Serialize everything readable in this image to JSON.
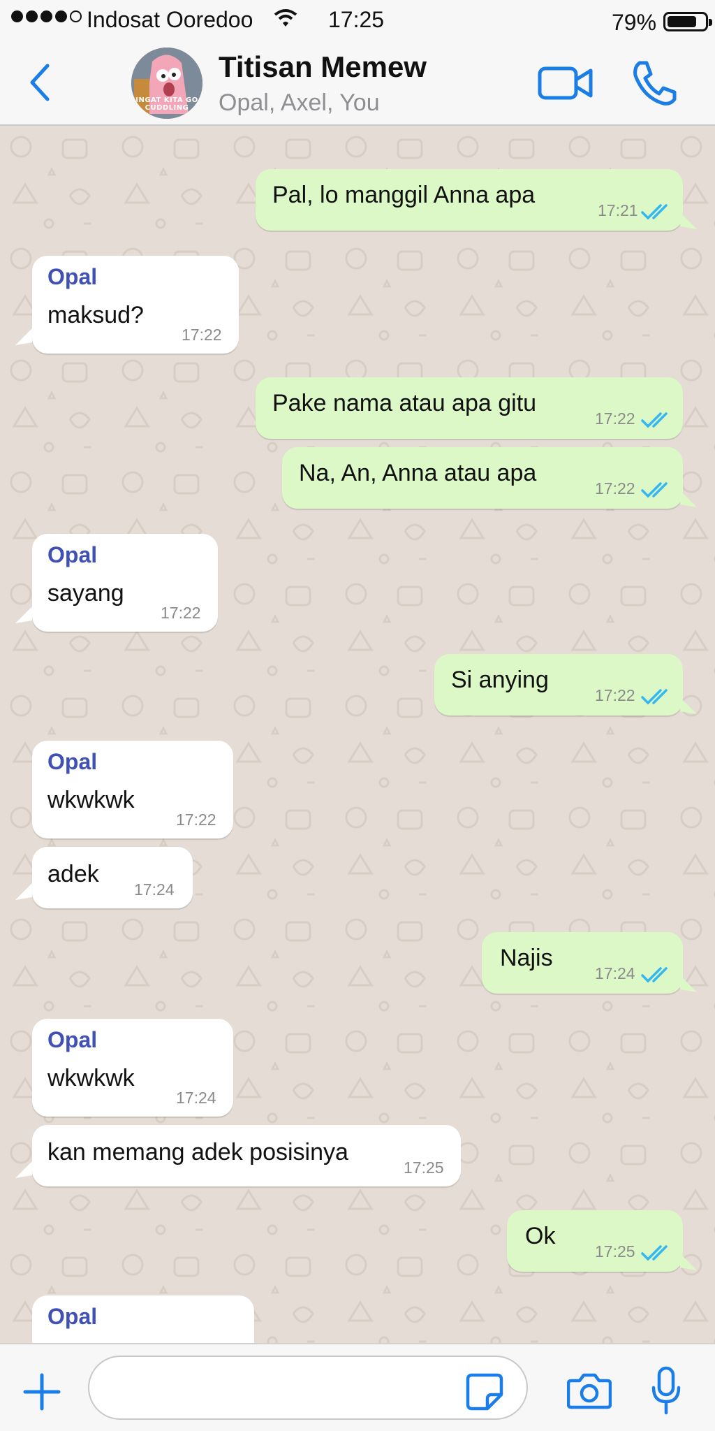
{
  "status_bar": {
    "carrier": "Indosat Ooredoo",
    "time": "17:25",
    "battery_percent": "79%",
    "battery_level": 0.79,
    "signal_bars": 4,
    "signal_max": 5,
    "icons": [
      "signal-dots-icon",
      "wifi-icon",
      "battery-icon"
    ]
  },
  "header": {
    "back_icon": "chevron-left-icon",
    "group_name": "Titisan Memew",
    "members": "Opal, Axel, You",
    "avatar_caption": "INGAT KITA GO CUDDLING",
    "actions": [
      "video-call-icon",
      "phone-call-icon"
    ]
  },
  "messages": [
    {
      "direction": "out",
      "text": "Pal, lo manggil Anna apa",
      "time": "17:21",
      "read": true,
      "tail": true
    },
    {
      "direction": "in",
      "sender": "Opal",
      "text": "maksud?",
      "time": "17:22",
      "tail": true
    },
    {
      "direction": "out",
      "text": "Pake nama atau apa gitu",
      "time": "17:22",
      "read": true,
      "tail": false
    },
    {
      "direction": "out",
      "text": "Na, An, Anna atau apa",
      "time": "17:22",
      "read": true,
      "tail": true
    },
    {
      "direction": "in",
      "sender": "Opal",
      "text": "sayang",
      "time": "17:22",
      "tail": true
    },
    {
      "direction": "out",
      "text": "Si anying",
      "time": "17:22",
      "read": true,
      "tail": true
    },
    {
      "direction": "in",
      "sender": "Opal",
      "text": "wkwkwk",
      "time": "17:22",
      "tail": false
    },
    {
      "direction": "in",
      "text": "adek",
      "time": "17:24",
      "tail": true
    },
    {
      "direction": "out",
      "text": "Najis",
      "time": "17:24",
      "read": true,
      "tail": true
    },
    {
      "direction": "in",
      "sender": "Opal",
      "text": "wkwkwk",
      "time": "17:24",
      "tail": false
    },
    {
      "direction": "in",
      "text": "kan memang adek posisinya",
      "time": "17:25",
      "tail": true
    },
    {
      "direction": "out",
      "text": "Ok",
      "time": "17:25",
      "read": true,
      "tail": true
    },
    {
      "direction": "in",
      "sender": "Opal",
      "text": "",
      "time": "",
      "tail": false
    }
  ],
  "input_bar": {
    "icons": [
      "plus-icon",
      "sticker-icon",
      "camera-icon",
      "mic-icon"
    ],
    "message_value": "",
    "placeholder": ""
  },
  "colors": {
    "accent": "#1a7ee6",
    "outgoing_bubble": "#dcf8c6",
    "incoming_bubble": "#ffffff",
    "sender_name": "#3f51b5",
    "read_ticks": "#34b7f1",
    "chat_background": "#e5ddd5"
  }
}
